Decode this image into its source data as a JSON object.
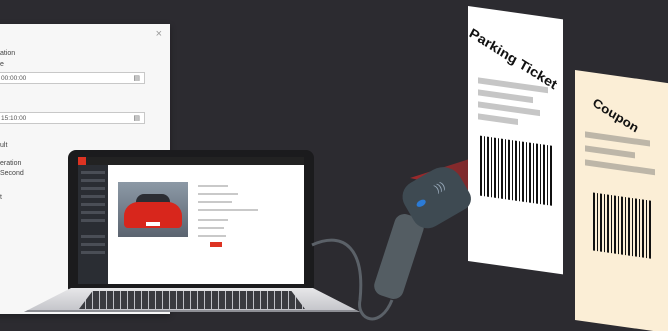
{
  "dialog": {
    "close_label": "×",
    "labels": [
      "ation",
      "e",
      "ult",
      "eration",
      "Second",
      "t"
    ],
    "start_time_value": "00:00:00",
    "end_time_value": "15:10:00",
    "calendar_icon": "calendar-icon"
  },
  "laptop": {
    "screen_icon": "car-photo"
  },
  "ticket": {
    "title": "Parking Ticket"
  },
  "coupon": {
    "title": "Coupon"
  },
  "colors": {
    "background": "#2c2b30",
    "coupon": "#fbeed6",
    "laser": "#dc2828",
    "scanner_accent": "#2b7bd6"
  }
}
